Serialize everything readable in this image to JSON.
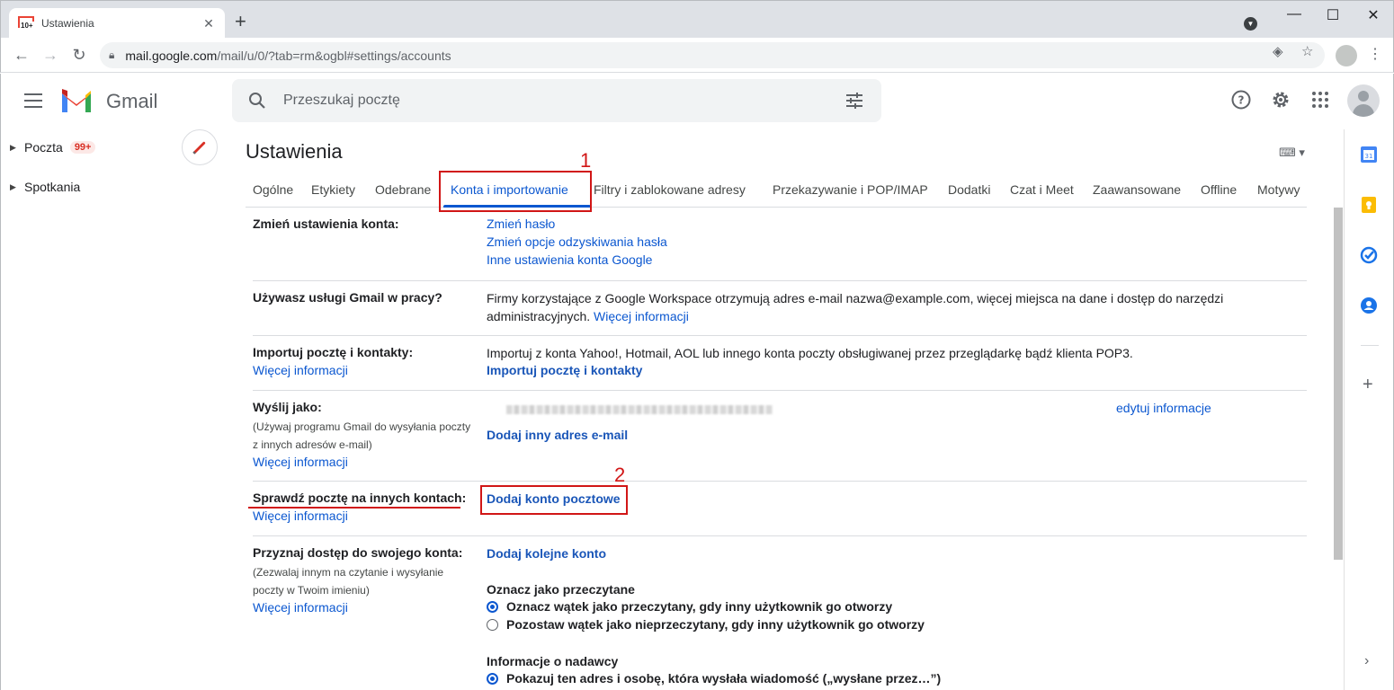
{
  "browser": {
    "tab_title": "Ustawienia",
    "favicon_badge": "10+",
    "url_host": "mail.google.com",
    "url_path": "/mail/u/0/?tab=rm&ogbl#settings/accounts"
  },
  "gmail": {
    "product_name": "Gmail",
    "search_placeholder": "Przeszukaj pocztę"
  },
  "sidebar": {
    "items": [
      {
        "label": "Poczta",
        "count": "99+"
      },
      {
        "label": "Spotkania"
      }
    ]
  },
  "settings": {
    "title": "Ustawienia",
    "tabs": [
      {
        "label": "Ogólne"
      },
      {
        "label": "Etykiety"
      },
      {
        "label": "Odebrane"
      },
      {
        "label": "Konta i importowanie",
        "active": true
      },
      {
        "label": "Filtry i zablokowane adresy"
      },
      {
        "label": "Przekazywanie i POP/IMAP"
      },
      {
        "label": "Dodatki"
      },
      {
        "label": "Czat i Meet"
      },
      {
        "label": "Zaawansowane"
      },
      {
        "label": "Offline"
      },
      {
        "label": "Motywy"
      }
    ],
    "sections": {
      "change_account": {
        "label": "Zmień ustawienia konta:",
        "links": [
          "Zmień hasło",
          "Zmień opcje odzyskiwania hasła",
          "Inne ustawienia konta Google"
        ]
      },
      "work": {
        "label": "Używasz usługi Gmail w pracy?",
        "text_line1": "Firmy korzystające z Google Workspace otrzymują adres e-mail nazwa@example.com, więcej miejsca na dane i dostęp do narzędzi",
        "text_line2": "administracyjnych.",
        "more": "Więcej informacji"
      },
      "import": {
        "label": "Importuj pocztę i kontakty:",
        "more": "Więcej informacji",
        "text": "Importuj z konta Yahoo!, Hotmail, AOL lub innego konta poczty obsługiwanej przez przeglądarkę bądź klienta POP3.",
        "action": "Importuj pocztę i kontakty"
      },
      "send_as": {
        "label": "Wyślij jako:",
        "sub_line1": "(Używaj programu Gmail do wysyłania poczty",
        "sub_line2": "z innych adresów e-mail)",
        "more": "Więcej informacji",
        "edit": "edytuj informacje",
        "action": "Dodaj inny adres e-mail"
      },
      "check_mail": {
        "label": "Sprawdź pocztę na innych kontach:",
        "more": "Więcej informacji",
        "action": "Dodaj konto pocztowe"
      },
      "grant": {
        "label": "Przyznaj dostęp do swojego konta:",
        "sub_line1": "(Zezwalaj innym na czytanie i wysyłanie",
        "sub_line2": "poczty w Twoim imieniu)",
        "more": "Więcej informacji",
        "action": "Dodaj kolejne konto",
        "mark_read_title": "Oznacz jako przeczytane",
        "mark_read_option1": "Oznacz wątek jako przeczytany, gdy inny użytkownik go otworzy",
        "mark_read_option2": "Pozostaw wątek jako nieprzeczytany, gdy inny użytkownik go otworzy",
        "sender_title": "Informacje o nadawcy",
        "sender_option1": "Pokazuj ten adres i osobę, która wysłała wiadomość („wysłane przez…”)"
      }
    }
  },
  "annotations": {
    "n1": "1",
    "n2": "2"
  },
  "colors": {
    "accent": "#0b57d0",
    "annotation": "#d11616"
  }
}
